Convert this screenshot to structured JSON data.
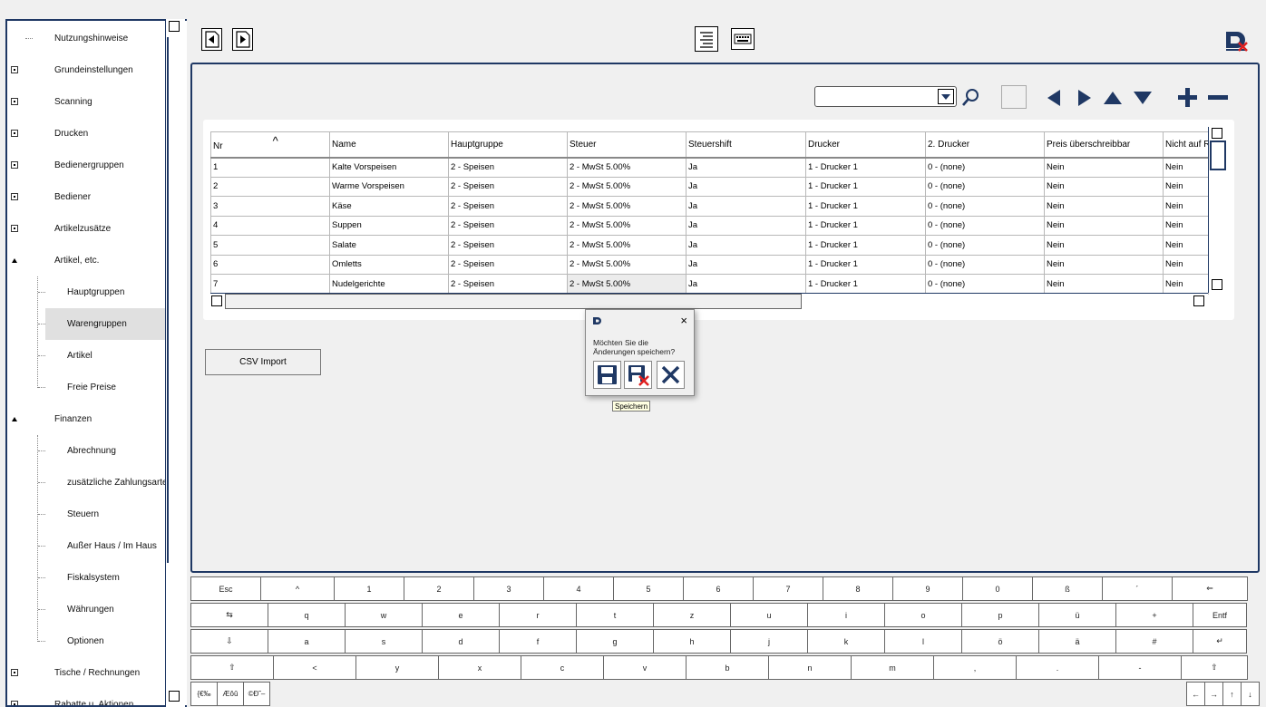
{
  "sidebar": {
    "items": [
      {
        "label": "Nutzungshinweise",
        "level": 1,
        "state": "leaf"
      },
      {
        "label": "Grundeinstellungen",
        "level": 1,
        "state": "collapsed"
      },
      {
        "label": "Scanning",
        "level": 1,
        "state": "collapsed"
      },
      {
        "label": "Drucken",
        "level": 1,
        "state": "collapsed"
      },
      {
        "label": "Bedienergruppen",
        "level": 1,
        "state": "collapsed"
      },
      {
        "label": "Bediener",
        "level": 1,
        "state": "collapsed"
      },
      {
        "label": "Artikelzusätze",
        "level": 1,
        "state": "collapsed"
      },
      {
        "label": "Artikel, etc.",
        "level": 1,
        "state": "expanded"
      },
      {
        "label": "Hauptgruppen",
        "level": 2,
        "state": "leaf"
      },
      {
        "label": "Warengruppen",
        "level": 2,
        "state": "leaf",
        "selected": true
      },
      {
        "label": "Artikel",
        "level": 2,
        "state": "leaf"
      },
      {
        "label": "Freie Preise",
        "level": 2,
        "state": "leaf"
      },
      {
        "label": "Finanzen",
        "level": 1,
        "state": "expanded"
      },
      {
        "label": "Abrechnung",
        "level": 2,
        "state": "leaf"
      },
      {
        "label": "zusätzliche Zahlungsarten",
        "level": 2,
        "state": "leaf"
      },
      {
        "label": "Steuern",
        "level": 2,
        "state": "leaf"
      },
      {
        "label": "Außer Haus / Im Haus",
        "level": 2,
        "state": "leaf"
      },
      {
        "label": "Fiskalsystem",
        "level": 2,
        "state": "leaf"
      },
      {
        "label": "Währungen",
        "level": 2,
        "state": "leaf"
      },
      {
        "label": "Optionen",
        "level": 2,
        "state": "leaf"
      },
      {
        "label": "Tische / Rechnungen",
        "level": 1,
        "state": "collapsed"
      },
      {
        "label": "Rabatte u. Aktionen",
        "level": 1,
        "state": "collapsed"
      }
    ]
  },
  "search": {
    "value": ""
  },
  "table": {
    "sort_indicator": "^",
    "columns": [
      "Nr",
      "Name",
      "Hauptgruppe",
      "Steuer",
      "Steuershift",
      "Drucker",
      "2. Drucker",
      "Preis überschreibbar",
      "Nicht auf R"
    ],
    "rows": [
      [
        "1",
        "Kalte Vorspeisen",
        "2 - Speisen",
        "2 - MwSt 5.00%",
        "Ja",
        "1 - Drucker 1",
        "0 - (none)",
        "Nein",
        "Nein"
      ],
      [
        "2",
        "Warme Vorspeisen",
        "2 - Speisen",
        "2 - MwSt 5.00%",
        "Ja",
        "1 - Drucker 1",
        "0 - (none)",
        "Nein",
        "Nein"
      ],
      [
        "3",
        "Käse",
        "2 - Speisen",
        "2 - MwSt 5.00%",
        "Ja",
        "1 - Drucker 1",
        "0 - (none)",
        "Nein",
        "Nein"
      ],
      [
        "4",
        "Suppen",
        "2 - Speisen",
        "2 - MwSt 5.00%",
        "Ja",
        "1 - Drucker 1",
        "0 - (none)",
        "Nein",
        "Nein"
      ],
      [
        "5",
        "Salate",
        "2 - Speisen",
        "2 - MwSt 5.00%",
        "Ja",
        "1 - Drucker 1",
        "0 - (none)",
        "Nein",
        "Nein"
      ],
      [
        "6",
        "Omletts",
        "2 - Speisen",
        "2 - MwSt 5.00%",
        "Ja",
        "1 - Drucker 1",
        "0 - (none)",
        "Nein",
        "Nein"
      ],
      [
        "7",
        "Nudelgerichte",
        "2 - Speisen",
        "2 - MwSt 5.00%",
        "Ja",
        "1 - Drucker 1",
        "0 - (none)",
        "Nein",
        "Nein"
      ]
    ]
  },
  "csv_button": {
    "label": "CSV Import"
  },
  "dialog": {
    "message_line1": "Möchten Sie die",
    "message_line2": "Änderungen speichern?",
    "close": "×",
    "tooltip": "Speichern"
  },
  "keyboard": {
    "rows": [
      [
        "Esc",
        "^",
        "1",
        "2",
        "3",
        "4",
        "5",
        "6",
        "7",
        "8",
        "9",
        "0",
        "ß",
        "´",
        "⇐"
      ],
      [
        "⇆",
        "q",
        "w",
        "e",
        "r",
        "t",
        "z",
        "u",
        "i",
        "o",
        "p",
        "ü",
        "+",
        "Entf"
      ],
      [
        "⇩",
        "a",
        "s",
        "d",
        "f",
        "g",
        "h",
        "j",
        "k",
        "l",
        "ö",
        "ä",
        "#",
        "↵"
      ],
      [
        "⇧",
        "<",
        "y",
        "x",
        "c",
        "v",
        "b",
        "n",
        "m",
        ",",
        ".",
        "-",
        "⇧"
      ]
    ],
    "mode_keys": [
      "{€‰",
      "Æôû",
      "©Ð˜–"
    ],
    "arrow_keys": [
      "←",
      "→",
      "↑",
      "↓"
    ]
  },
  "colors": {
    "accent": "#1f3864",
    "danger": "#e02020"
  }
}
